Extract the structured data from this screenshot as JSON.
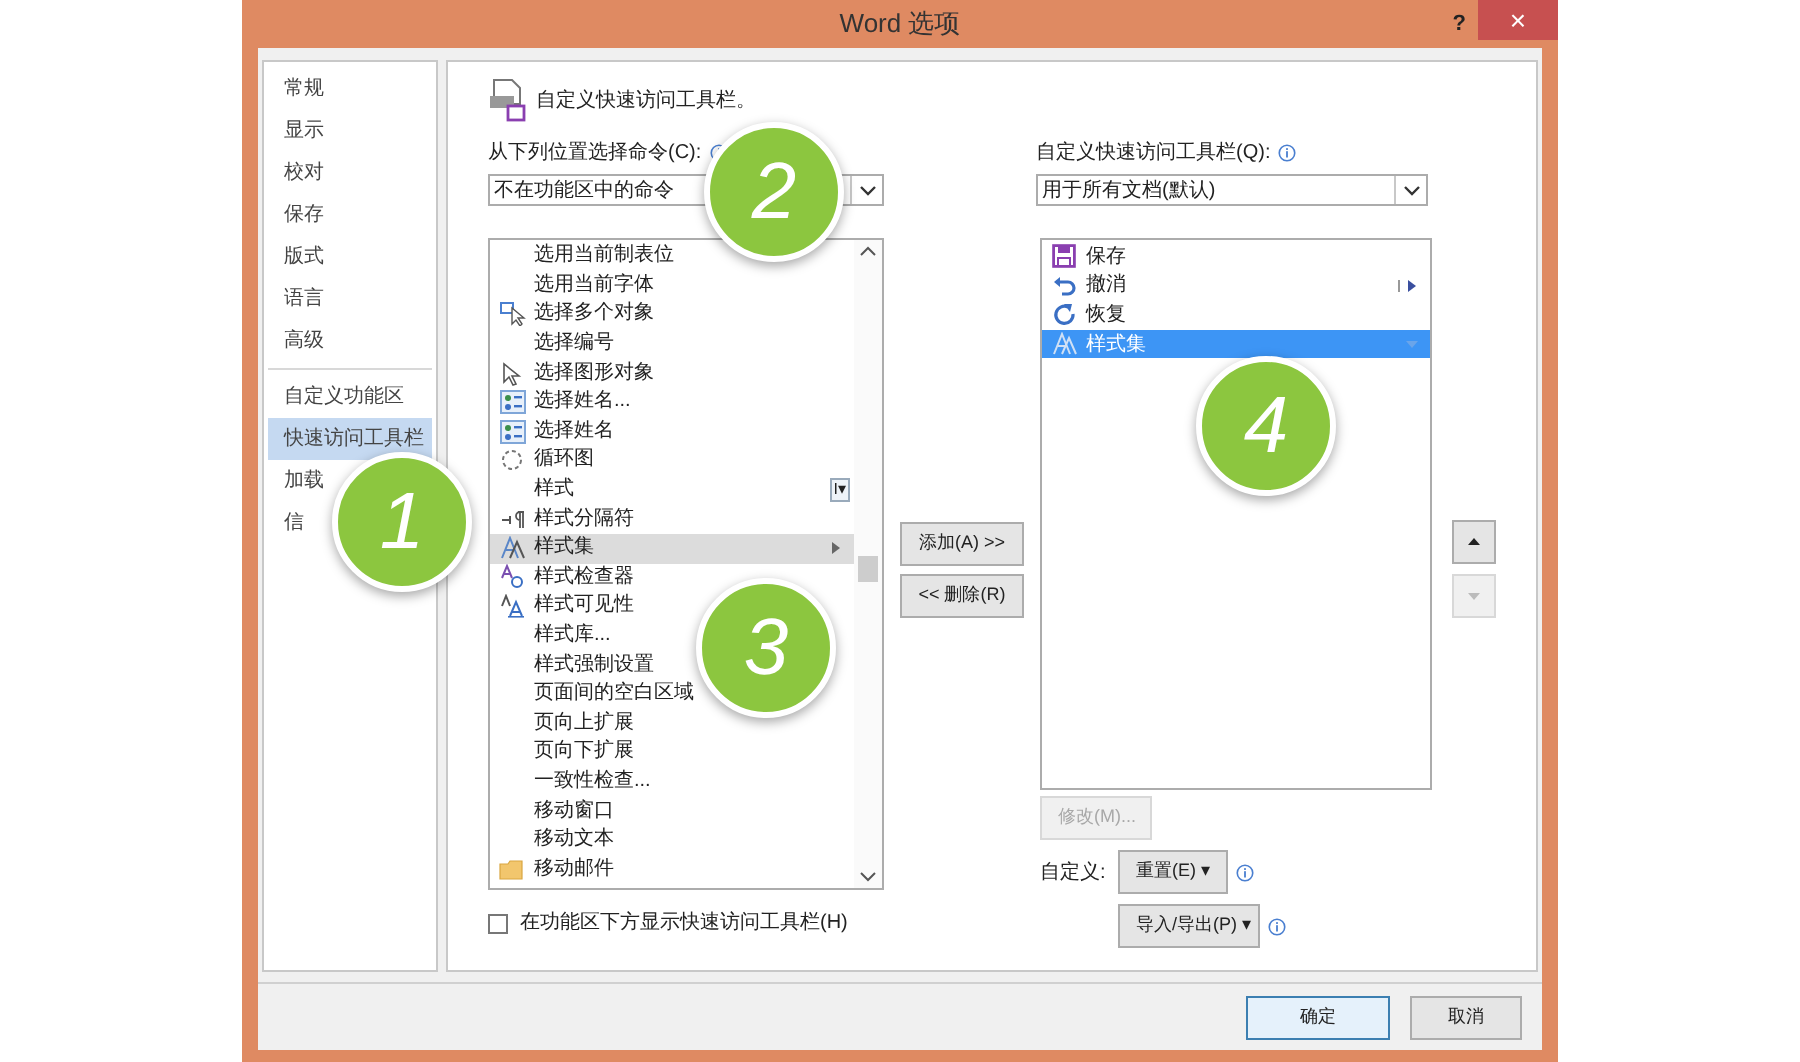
{
  "window": {
    "title": "Word 选项",
    "help": "?",
    "close": "×"
  },
  "sidebar": {
    "items": [
      {
        "label": "常规",
        "selected": false
      },
      {
        "label": "显示",
        "selected": false
      },
      {
        "label": "校对",
        "selected": false
      },
      {
        "label": "保存",
        "selected": false
      },
      {
        "label": "版式",
        "selected": false
      },
      {
        "label": "语言",
        "selected": false
      },
      {
        "label": "高级",
        "selected": false
      },
      {
        "label": "自定义功能区",
        "selected": false,
        "divider_before": true
      },
      {
        "label": "快速访问工具栏",
        "selected": true
      },
      {
        "label": "加载",
        "selected": false
      },
      {
        "label": "信",
        "selected": false
      }
    ]
  },
  "heading": "自定义快速访问工具栏。",
  "source": {
    "label": "从下列位置选择命令(C):",
    "value": "不在功能区中的命令"
  },
  "target": {
    "label": "自定义快速访问工具栏(Q):",
    "value": "用于所有文档(默认)"
  },
  "commands": [
    {
      "label": "选用当前制表位",
      "kind": "plain",
      "selected": false
    },
    {
      "label": "选用当前字体",
      "kind": "plain",
      "selected": false
    },
    {
      "label": "选择多个对象",
      "kind": "multi",
      "selected": false
    },
    {
      "label": "选择编号",
      "kind": "plain",
      "selected": false
    },
    {
      "label": "选择图形对象",
      "kind": "pointer",
      "selected": false
    },
    {
      "label": "选择姓名...",
      "kind": "names",
      "selected": false
    },
    {
      "label": "选择姓名",
      "kind": "names",
      "selected": false
    },
    {
      "label": "循环图",
      "kind": "cycle",
      "selected": false
    },
    {
      "label": "样式",
      "kind": "plain",
      "selected": false,
      "trailing": "I▾"
    },
    {
      "label": "样式分隔符",
      "kind": "pilcrow",
      "selected": false
    },
    {
      "label": "样式集",
      "kind": "styleset",
      "selected": true,
      "submenu": true
    },
    {
      "label": "样式检查器",
      "kind": "inspector",
      "selected": false
    },
    {
      "label": "样式可见性",
      "kind": "visibility",
      "selected": false
    },
    {
      "label": "样式库...",
      "kind": "plain",
      "selected": false
    },
    {
      "label": "样式强制设置",
      "kind": "plain",
      "selected": false
    },
    {
      "label": "页面间的空白区域",
      "kind": "plain",
      "selected": false
    },
    {
      "label": "页向上扩展",
      "kind": "plain",
      "selected": false
    },
    {
      "label": "页向下扩展",
      "kind": "plain",
      "selected": false
    },
    {
      "label": "一致性检查...",
      "kind": "plain",
      "selected": false
    },
    {
      "label": "移动窗口",
      "kind": "plain",
      "selected": false
    },
    {
      "label": "移动文本",
      "kind": "plain",
      "selected": false
    },
    {
      "label": "移动邮件",
      "kind": "folder",
      "selected": false
    }
  ],
  "add_button": "添加(A) >>",
  "remove_button": "<< 删除(R)",
  "toolbar_items": [
    {
      "label": "保存",
      "kind": "save",
      "selected": false
    },
    {
      "label": "撤消",
      "kind": "undo",
      "selected": false,
      "submenu": true
    },
    {
      "label": "恢复",
      "kind": "redo",
      "selected": false
    },
    {
      "label": "样式集",
      "kind": "styleset",
      "selected": true,
      "submenu": true
    }
  ],
  "move_up": {
    "disabled": false
  },
  "move_down": {
    "disabled": true
  },
  "modify_button": {
    "label": "修改(M)...",
    "disabled": true
  },
  "customize_label": "自定义:",
  "reset_button": "重置(E) ▾",
  "import_export_button": "导入/导出(P) ▾",
  "show_below": {
    "label": "在功能区下方显示快速访问工具栏(H)",
    "checked": false
  },
  "ok_button": "确定",
  "cancel_button": "取消",
  "callouts": [
    "1",
    "2",
    "3",
    "4"
  ]
}
